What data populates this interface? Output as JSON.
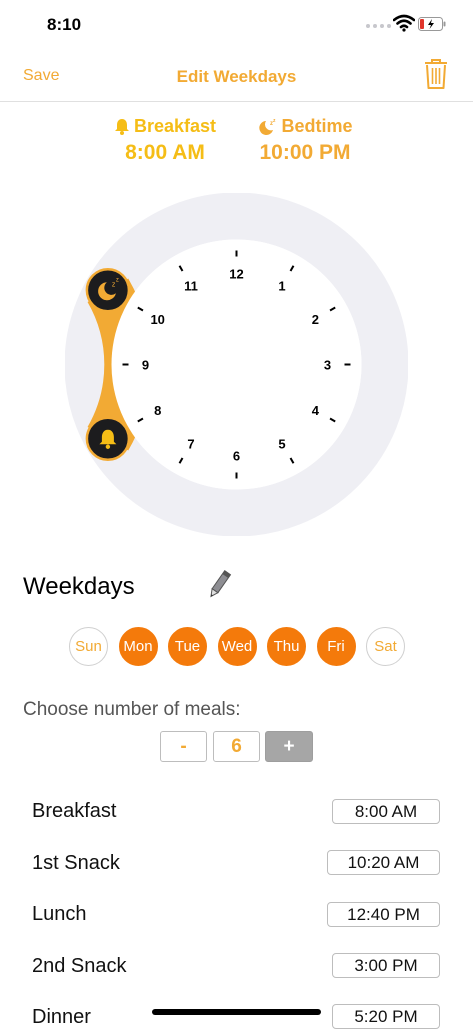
{
  "status_bar": {
    "time": "8:10"
  },
  "nav": {
    "save_label": "Save",
    "title": "Edit Weekdays"
  },
  "schedule": {
    "breakfast_label": "Breakfast",
    "breakfast_time": "8:00 AM",
    "bedtime_label": "Bedtime",
    "bedtime_time": "10:00 PM"
  },
  "clock": {
    "numbers": [
      "12",
      "1",
      "2",
      "3",
      "4",
      "5",
      "6",
      "7",
      "8",
      "9",
      "10",
      "11"
    ]
  },
  "weekdays": {
    "title": "Weekdays",
    "days": [
      {
        "label": "Sun",
        "selected": false
      },
      {
        "label": "Mon",
        "selected": true
      },
      {
        "label": "Tue",
        "selected": true
      },
      {
        "label": "Wed",
        "selected": true
      },
      {
        "label": "Thu",
        "selected": true
      },
      {
        "label": "Fri",
        "selected": true
      },
      {
        "label": "Sat",
        "selected": false
      }
    ]
  },
  "meals": {
    "label": "Choose number of meals:",
    "minus": "-",
    "count": "6",
    "plus": "+",
    "items": [
      {
        "name": "Breakfast",
        "time": "8:00 AM"
      },
      {
        "name": "1st Snack",
        "time": "10:20 AM"
      },
      {
        "name": "Lunch",
        "time": "12:40 PM"
      },
      {
        "name": "2nd Snack",
        "time": "3:00 PM"
      },
      {
        "name": "Dinner",
        "time": "5:20 PM"
      }
    ]
  },
  "colors": {
    "accent": "#f2aa34",
    "yellow": "#f5bd16",
    "day_selected": "#f47a0b",
    "ring_bg": "#efeff4"
  }
}
